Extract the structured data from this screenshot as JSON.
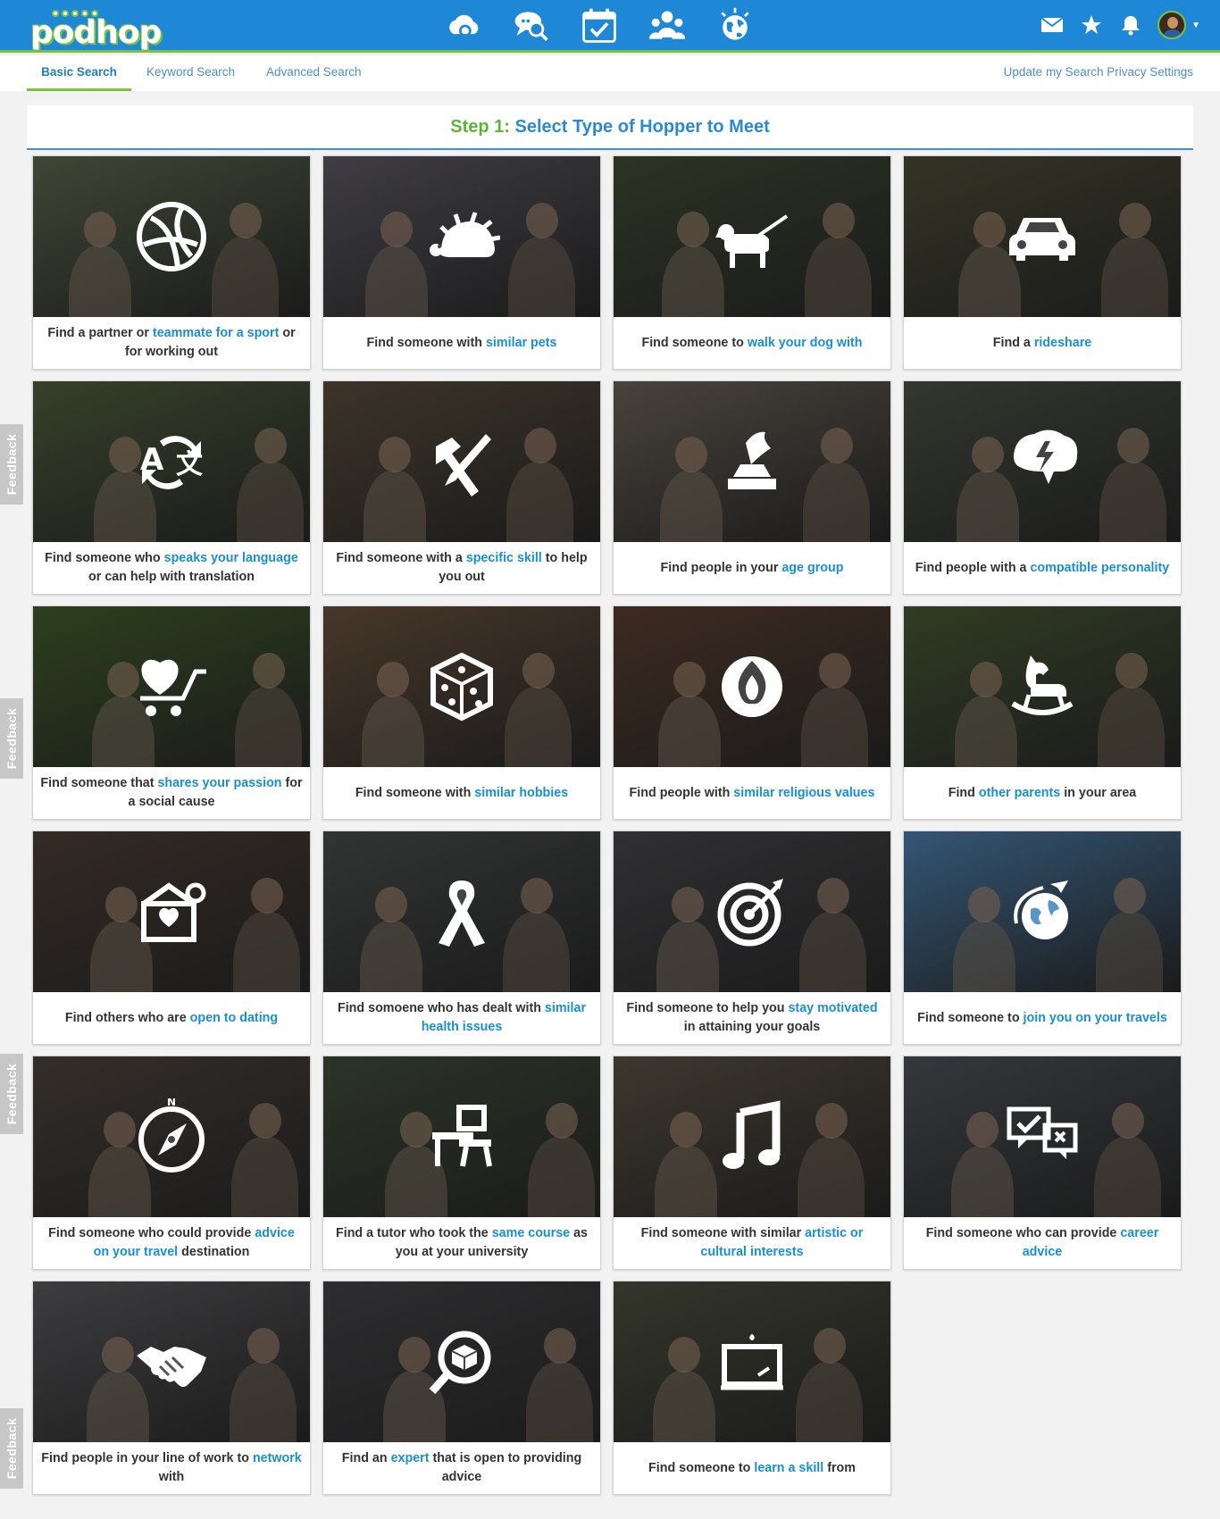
{
  "brand": {
    "name": "podhop"
  },
  "colors": {
    "topbar": "#1e88d6",
    "accent_green": "#7cc242",
    "link_blue": "#1a8fd1"
  },
  "top_nav": {
    "icons": [
      "cloud-search-icon",
      "chat-search-icon",
      "calendar-check-icon",
      "group-icon",
      "globe-icon"
    ],
    "right_icons": [
      "mail-icon",
      "star-icon",
      "bell-icon",
      "avatar"
    ]
  },
  "subnav": {
    "tabs": [
      {
        "label": "Basic Search",
        "active": true
      },
      {
        "label": "Keyword Search",
        "active": false
      },
      {
        "label": "Advanced Search",
        "active": false
      }
    ],
    "privacy_link": "Update my Search Privacy Settings"
  },
  "step": {
    "prefix": "Step 1:",
    "title": "Select Type of Hopper to Meet"
  },
  "feedback_label": "Feedback",
  "cards": [
    {
      "icon": "volleyball-icon",
      "tint": "#6c7a5c",
      "parts": [
        [
          "Find a partner or ",
          0
        ],
        [
          "teammate for a sport",
          1
        ],
        [
          " or for working out",
          0
        ]
      ]
    },
    {
      "icon": "hedgehog-icon",
      "tint": "#6d6a74",
      "parts": [
        [
          "Find someone with ",
          0
        ],
        [
          "similar pets",
          1
        ]
      ]
    },
    {
      "icon": "dog-walk-icon",
      "tint": "#4c5a3e",
      "parts": [
        [
          "Find someone to ",
          0
        ],
        [
          "walk your dog with",
          1
        ]
      ]
    },
    {
      "icon": "car-icon",
      "tint": "#5a5a40",
      "parts": [
        [
          "Find a ",
          0
        ],
        [
          "rideshare",
          1
        ]
      ]
    },
    {
      "icon": "translate-icon",
      "tint": "#5e7049",
      "parts": [
        [
          "Find someone who ",
          0
        ],
        [
          "speaks your language",
          1
        ],
        [
          " or can help with translation",
          0
        ]
      ]
    },
    {
      "icon": "tools-icon",
      "tint": "#6a5a48",
      "parts": [
        [
          "Find someone with a ",
          0
        ],
        [
          "specific skill",
          1
        ],
        [
          " to help you out",
          0
        ]
      ]
    },
    {
      "icon": "gramophone-icon",
      "tint": "#7d7468",
      "parts": [
        [
          "Find people in your ",
          0
        ],
        [
          "age group",
          1
        ]
      ]
    },
    {
      "icon": "brain-bolt-icon",
      "tint": "#586050",
      "parts": [
        [
          "Find people with a ",
          0
        ],
        [
          "compatible personality",
          1
        ]
      ]
    },
    {
      "icon": "heart-cart-icon",
      "tint": "#4e6e34",
      "parts": [
        [
          "Find someone that ",
          0
        ],
        [
          "shares your passion",
          1
        ],
        [
          " for a social cause",
          0
        ]
      ]
    },
    {
      "icon": "dice-icon",
      "tint": "#7a6048",
      "parts": [
        [
          "Find someone with ",
          0
        ],
        [
          "similar hobbies",
          1
        ]
      ]
    },
    {
      "icon": "flame-circle-icon",
      "tint": "#6a4a3a",
      "parts": [
        [
          "Find people with ",
          0
        ],
        [
          "similar religious values",
          1
        ]
      ]
    },
    {
      "icon": "rocking-horse-icon",
      "tint": "#54683e",
      "parts": [
        [
          "Find ",
          0
        ],
        [
          "other parents",
          1
        ],
        [
          " in your area",
          0
        ]
      ]
    },
    {
      "icon": "love-letter-icon",
      "tint": "#5a4a40",
      "parts": [
        [
          "Find others who are ",
          0
        ],
        [
          "open to dating",
          1
        ]
      ]
    },
    {
      "icon": "ribbon-icon",
      "tint": "#585a5a",
      "parts": [
        [
          "Find somoene who has dealt with ",
          0
        ],
        [
          "similar health issues",
          1
        ]
      ]
    },
    {
      "icon": "target-icon",
      "tint": "#545458",
      "parts": [
        [
          "Find someone to help you ",
          0
        ],
        [
          "stay motivated",
          1
        ],
        [
          " in attaining your goals",
          0
        ]
      ]
    },
    {
      "icon": "travel-globe-icon",
      "tint": "#5a94c8",
      "parts": [
        [
          "Find someone to ",
          0
        ],
        [
          "join you on your travels",
          1
        ]
      ]
    },
    {
      "icon": "compass-icon",
      "tint": "#5a5048",
      "parts": [
        [
          "Find someone who could provide ",
          0
        ],
        [
          "advice on your travel",
          1
        ],
        [
          " destination",
          0
        ]
      ]
    },
    {
      "icon": "school-desk-icon",
      "tint": "#4c5a44",
      "parts": [
        [
          "Find a tutor who took the ",
          0
        ],
        [
          "same course",
          1
        ],
        [
          " as you at your university",
          0
        ]
      ]
    },
    {
      "icon": "music-note-icon",
      "tint": "#6a6050",
      "parts": [
        [
          "Find someone with similar ",
          0
        ],
        [
          "artistic or cultural interests",
          1
        ]
      ]
    },
    {
      "icon": "chat-check-icon",
      "tint": "#5c6068",
      "parts": [
        [
          "Find someone who can provide ",
          0
        ],
        [
          "career advice",
          1
        ]
      ]
    },
    {
      "icon": "handshake-icon",
      "tint": "#6a6a6e",
      "parts": [
        [
          "Find people in your line of work to ",
          0
        ],
        [
          "network",
          1
        ],
        [
          " with",
          0
        ]
      ]
    },
    {
      "icon": "magnifier-cube-icon",
      "tint": "#505054",
      "parts": [
        [
          "Find an ",
          0
        ],
        [
          "expert",
          1
        ],
        [
          " that is open to providing advice",
          0
        ]
      ]
    },
    {
      "icon": "chalkboard-icon",
      "tint": "#5a5e4a",
      "parts": [
        [
          "Find someone to ",
          0
        ],
        [
          "learn a skill",
          1
        ],
        [
          " from",
          0
        ]
      ]
    }
  ]
}
